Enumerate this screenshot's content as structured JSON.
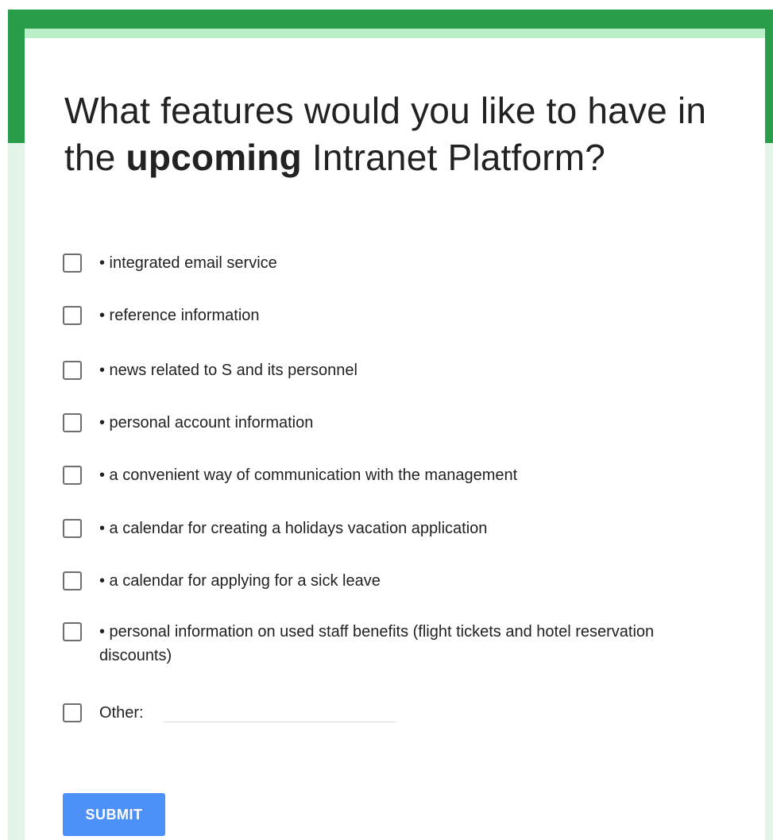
{
  "form": {
    "title_part1": "What features would you like to have in the ",
    "title_emphasis": "upcoming",
    "title_part2": " Intranet Platform?",
    "options": [
      {
        "label": "• integrated email service",
        "checked": false
      },
      {
        "label": "• reference information",
        "checked": false
      },
      {
        "label": "• news related to S and its personnel",
        "checked": false
      },
      {
        "label": "• personal account information",
        "checked": false
      },
      {
        "label": "• a convenient way of communication with the management",
        "checked": false
      },
      {
        "label": "• a calendar for creating a holidays vacation application",
        "checked": false
      },
      {
        "label": "• a calendar for applying for a sick leave",
        "checked": false
      },
      {
        "label": "• personal information on used staff benefits (flight tickets and hotel reservation discounts)",
        "checked": false
      }
    ],
    "other": {
      "label": "Other:",
      "value": "",
      "checked": false
    },
    "submit_label": "SUBMIT"
  },
  "colors": {
    "header_green": "#2a9d4b",
    "card_accent": "#b9f0c8",
    "page_background": "#e5f4e8",
    "submit_blue": "#4d90f7"
  }
}
